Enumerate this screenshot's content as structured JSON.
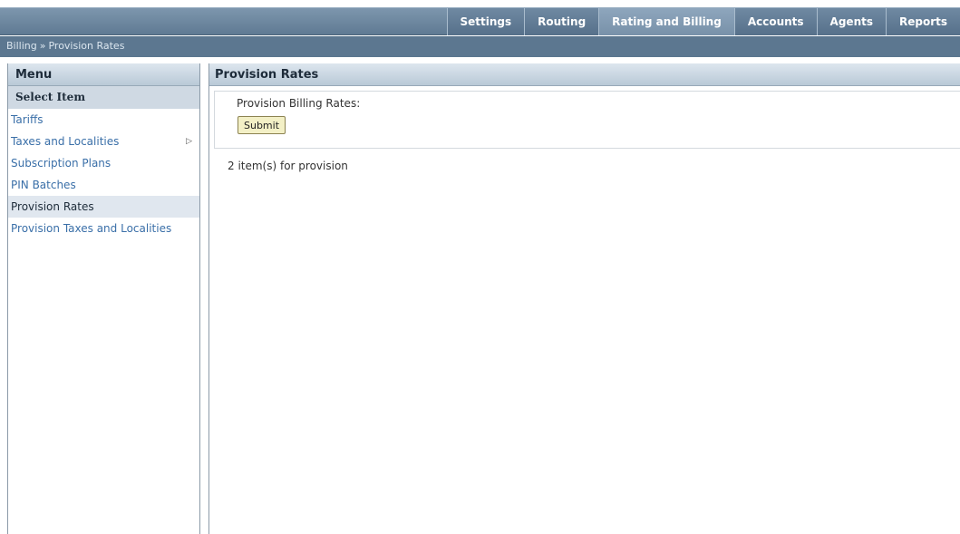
{
  "nav": {
    "tabs": [
      {
        "label": "Settings"
      },
      {
        "label": "Routing"
      },
      {
        "label": "Rating and Billing"
      },
      {
        "label": "Accounts"
      },
      {
        "label": "Agents"
      },
      {
        "label": "Reports"
      }
    ],
    "active_tab": "Rating and Billing"
  },
  "breadcrumb": {
    "parent": "Billing",
    "separator": "»",
    "current": "Provision Rates"
  },
  "sidebar": {
    "title": "Menu",
    "subtitle": "Select Item",
    "items": [
      {
        "label": "Tariffs"
      },
      {
        "label": "Taxes and Localities",
        "arrow": "▷"
      },
      {
        "label": "Subscription Plans"
      },
      {
        "label": "PIN Batches"
      },
      {
        "label": "Provision Rates"
      },
      {
        "label": "Provision Taxes and Localities"
      }
    ]
  },
  "main": {
    "title": "Provision Rates",
    "form_label": "Provision Billing Rates:",
    "submit_label": "Submit",
    "count_text": "2 item(s) for provision"
  },
  "colors": {
    "nav_bg": "#6f89a2",
    "link": "#3a6fa8",
    "button_bg": "#f3f0c6"
  }
}
